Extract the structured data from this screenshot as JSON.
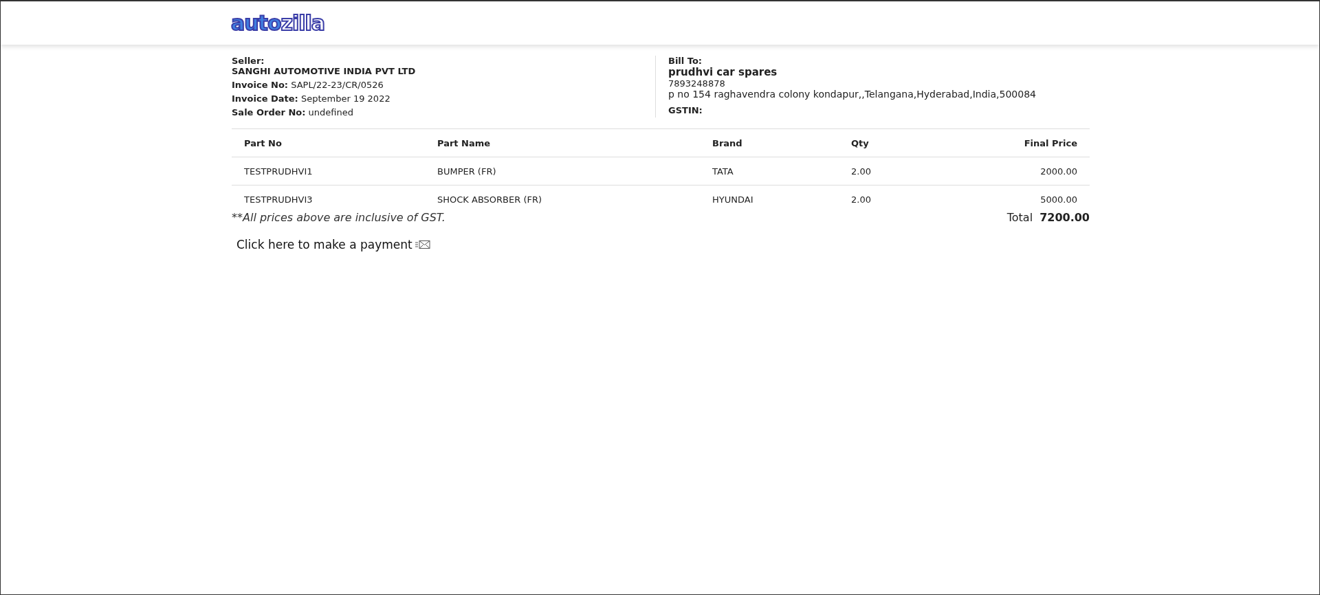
{
  "logo": {
    "first": "auto",
    "second": "zilla"
  },
  "seller": {
    "heading": "Seller:",
    "name": "SANGHI AUTOMOTIVE INDIA PVT LTD",
    "fields": [
      {
        "label": "Invoice No:",
        "value": "SAPL/22-23/CR/0526"
      },
      {
        "label": "Invoice Date:",
        "value": "September 19 2022"
      },
      {
        "label": "Sale Order No:",
        "value": "undefined"
      }
    ]
  },
  "bill_to": {
    "heading": "Bill To:",
    "name": "prudhvi car spares",
    "phone": "7893248878",
    "address": "p no 154 raghavendra colony kondapur,,Telangana,Hyderabad,India,500084",
    "gstin_label": "GSTIN:"
  },
  "table": {
    "columns": [
      "Part No",
      "Part Name",
      "Brand",
      "Qty",
      "Final Price"
    ],
    "rows": [
      [
        "TESTPRUDHVI1",
        "BUMPER (FR)",
        "TATA",
        "2.00",
        "2000.00"
      ],
      [
        "TESTPRUDHVI3",
        "SHOCK ABSORBER (FR)",
        "HYUNDAI",
        "2.00",
        "5000.00"
      ]
    ]
  },
  "note": "**All prices above are inclusive of GST.",
  "total": {
    "label": "Total",
    "value": "7200.00"
  },
  "payment_link": "Click here to make a payment"
}
